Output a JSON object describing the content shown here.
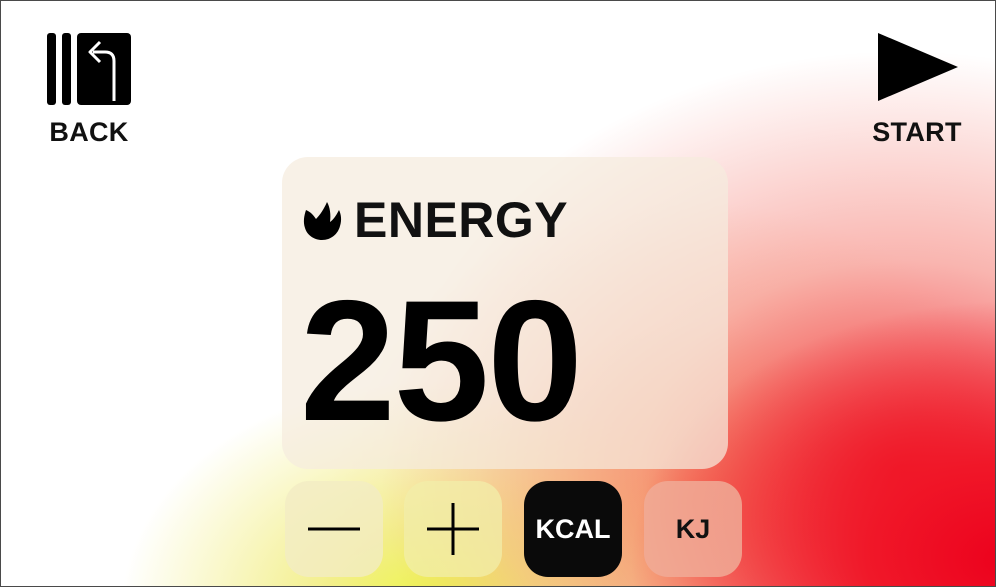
{
  "header": {
    "back_label": "BACK",
    "start_label": "START"
  },
  "panel": {
    "title": "ENERGY",
    "value": "250"
  },
  "controls": {
    "unit_kcal": "KCAL",
    "unit_kj": "KJ",
    "selected_unit": "KCAL"
  },
  "colors": {
    "accent_red": "#ec001c",
    "accent_yellow": "#ecf646",
    "text": "#111111",
    "selected_bg": "#0a0a0a"
  }
}
